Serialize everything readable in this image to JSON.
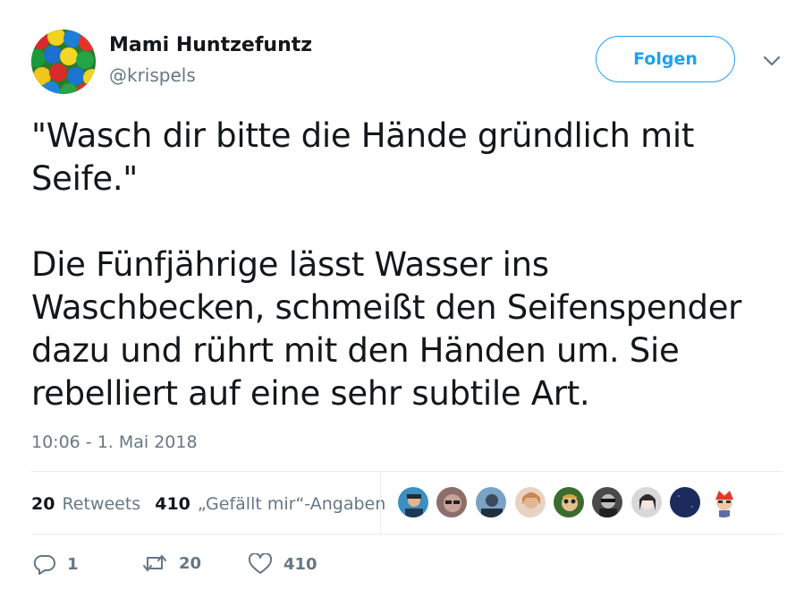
{
  "author": {
    "name": "Mami Huntzefuntz",
    "handle": "@krispels",
    "avatar_icon": "colorful-ball-pit-avatar"
  },
  "follow_button": {
    "label": "Folgen",
    "color": "#1da1f2"
  },
  "menu": {
    "icon": "chevron-down-icon"
  },
  "tweet": {
    "paragraph1": "\"Wasch dir bitte die Hände gründlich mit Seife.\"",
    "paragraph2": "Die Fünfjährige lässt Wasser ins Waschbecken, schmeißt den Seifenspender dazu und rührt mit den Händen um. Sie rebelliert auf eine sehr subtile Art."
  },
  "timestamp": "10:06 - 1. Mai 2018",
  "stats": {
    "retweets_count": "20",
    "retweets_label": "Retweets",
    "likes_count": "410",
    "likes_label": "„Gefällt mir“-Angaben"
  },
  "likers": [
    {
      "icon": "liker-avatar-1"
    },
    {
      "icon": "liker-avatar-2"
    },
    {
      "icon": "liker-avatar-3"
    },
    {
      "icon": "liker-avatar-4"
    },
    {
      "icon": "liker-avatar-5"
    },
    {
      "icon": "liker-avatar-6"
    },
    {
      "icon": "liker-avatar-7"
    },
    {
      "icon": "liker-avatar-8"
    },
    {
      "icon": "liker-avatar-9"
    }
  ],
  "actions": {
    "reply": {
      "icon": "reply-icon",
      "count": "1"
    },
    "retweet": {
      "icon": "retweet-icon",
      "count": "20"
    },
    "like": {
      "icon": "heart-icon",
      "count": "410"
    }
  },
  "colors": {
    "text": "#14171a",
    "secondary": "#657786",
    "accent": "#1da1f2",
    "divider": "#e6ecf0"
  }
}
